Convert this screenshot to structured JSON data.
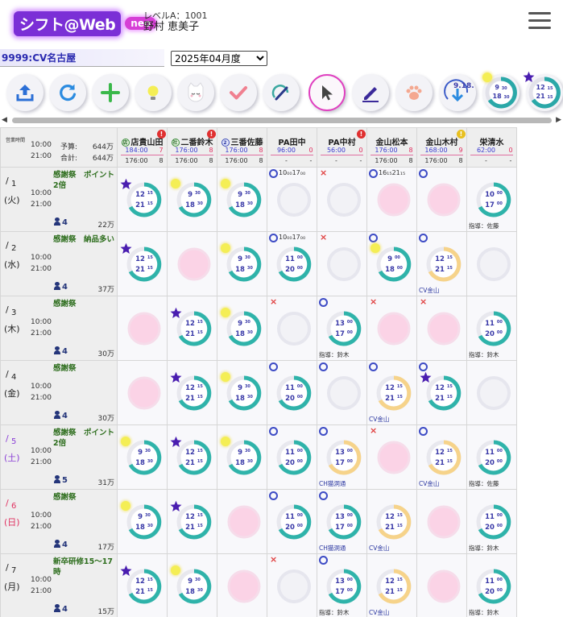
{
  "app": {
    "logo": "シフト@Web",
    "logo_badge": "neo",
    "level": "レベルA：1001",
    "user_name": "野村 恵美子"
  },
  "store": "9999:CV名古屋",
  "month": {
    "selected": "2025年04月度"
  },
  "toolbar": {
    "badge_sun_time": {
      "start": "9",
      "start_m": "30",
      "end": "18",
      "end_m": "30"
    },
    "badge_star_time": {
      "start": "12",
      "start_m": "15",
      "end": "21",
      "end_m": "15"
    },
    "download_label": "9.18."
  },
  "corner": {
    "label": "営業時間",
    "open": "10:00",
    "close": "21:00",
    "budget_label": "予算:",
    "budget_value": "644万",
    "total_label": "合計:",
    "total_value": "644万"
  },
  "staff": [
    {
      "name": "店貴山田",
      "badge": "店",
      "badge_color": "g",
      "alert": "!",
      "alert_color": "r",
      "h1": "184:00",
      "h1b": "7",
      "h2": "176:00",
      "h2b": "8"
    },
    {
      "name": "二番鈴木",
      "badge": "社",
      "badge_color": "g",
      "alert": "!",
      "alert_color": "r",
      "h1": "176:00",
      "h1b": "8",
      "h2": "176:00",
      "h2b": "8"
    },
    {
      "name": "三番佐藤",
      "badge": "2",
      "badge_color": "b",
      "alert": "",
      "alert_color": "",
      "h1": "176:00",
      "h1b": "8",
      "h2": "176:00",
      "h2b": "8"
    },
    {
      "name": "PA田中",
      "badge": "",
      "badge_color": "",
      "alert": "",
      "alert_color": "",
      "h1": "96:00",
      "h1b": "0",
      "h2": "-",
      "h2b": "-"
    },
    {
      "name": "PA中村",
      "badge": "",
      "badge_color": "",
      "alert": "!",
      "alert_color": "r",
      "h1": "56:00",
      "h1b": "0",
      "h2": "-",
      "h2b": "-"
    },
    {
      "name": "金山松本",
      "badge": "",
      "badge_color": "",
      "alert": "",
      "alert_color": "",
      "h1": "176:00",
      "h1b": "8",
      "h2": "176:00",
      "h2b": "8"
    },
    {
      "name": "金山木村",
      "badge": "",
      "badge_color": "",
      "alert": "!",
      "alert_color": "y",
      "h1": "168:00",
      "h1b": "9",
      "h2": "176:00",
      "h2b": "8"
    },
    {
      "name": "栄清水",
      "badge": "",
      "badge_color": "",
      "alert": "",
      "alert_color": "",
      "h1": "62:00",
      "h1b": "0",
      "h2": "-",
      "h2b": "-"
    }
  ],
  "days": [
    {
      "slash": "/",
      "num": "1",
      "wd": "(火)",
      "wd_color": "#222",
      "open": "10:00",
      "close": "21:00",
      "memo": "感謝祭　ポイント2倍",
      "staff_count": "4",
      "budget": "22万",
      "cells": [
        {
          "mark": "star",
          "time": [
            "12",
            "15",
            "21",
            "15"
          ],
          "ring": "teal"
        },
        {
          "mark": "sun",
          "time": [
            "9",
            "30",
            "18",
            "30"
          ],
          "ring": "teal"
        },
        {
          "mark": "sun",
          "time": [
            "9",
            "30",
            "18",
            "30"
          ],
          "ring": "teal"
        },
        {
          "mark": "o",
          "req": "10₀₀17₀₀",
          "ring": "empty"
        },
        {
          "mark": "x",
          "ring": "empty"
        },
        {
          "mark": "o",
          "req": "16₁₅21₁₅",
          "ring": "pink"
        },
        {
          "mark": "o",
          "ring": "pink"
        },
        {
          "mark": "",
          "time": [
            "10",
            "00",
            "17",
            "00"
          ],
          "ring": "teal",
          "note": "指導：佐藤"
        }
      ]
    },
    {
      "slash": "/",
      "num": "2",
      "wd": "(水)",
      "wd_color": "#222",
      "open": "10:00",
      "close": "21:00",
      "memo": "感謝祭　納品多い",
      "staff_count": "4",
      "budget": "37万",
      "cells": [
        {
          "mark": "star",
          "time": [
            "12",
            "15",
            "21",
            "15"
          ],
          "ring": "teal"
        },
        {
          "mark": "",
          "ring": "pink"
        },
        {
          "mark": "sun",
          "time": [
            "9",
            "30",
            "18",
            "30"
          ],
          "ring": "teal"
        },
        {
          "mark": "o",
          "req": "10₀₀17₀₀",
          "time": [
            "11",
            "00",
            "20",
            "00"
          ],
          "ring": "teal"
        },
        {
          "mark": "x",
          "ring": "empty"
        },
        {
          "mark": "o-sun",
          "time": [
            "9",
            "00",
            "18",
            "00"
          ],
          "ring": "teal"
        },
        {
          "mark": "o",
          "time": [
            "12",
            "15",
            "21",
            "15"
          ],
          "ring": "yellow",
          "note": "CV金山",
          "note_blue": true
        },
        {
          "mark": "",
          "ring": "empty"
        }
      ]
    },
    {
      "slash": "/",
      "num": "3",
      "wd": "(木)",
      "wd_color": "#222",
      "open": "10:00",
      "close": "21:00",
      "memo": "感謝祭",
      "staff_count": "4",
      "budget": "30万",
      "cells": [
        {
          "mark": "",
          "ring": "pink"
        },
        {
          "mark": "star",
          "time": [
            "12",
            "15",
            "21",
            "15"
          ],
          "ring": "teal"
        },
        {
          "mark": "sun",
          "time": [
            "9",
            "30",
            "18",
            "30"
          ],
          "ring": "teal"
        },
        {
          "mark": "x",
          "ring": "empty"
        },
        {
          "mark": "o",
          "time": [
            "13",
            "00",
            "17",
            "00"
          ],
          "ring": "teal",
          "note": "指導：鈴木"
        },
        {
          "mark": "x",
          "ring": "pink"
        },
        {
          "mark": "x",
          "ring": "pink"
        },
        {
          "mark": "",
          "time": [
            "11",
            "00",
            "20",
            "00"
          ],
          "ring": "teal",
          "note": "指導：鈴木"
        }
      ]
    },
    {
      "slash": "/",
      "num": "4",
      "wd": "(金)",
      "wd_color": "#222",
      "open": "10:00",
      "close": "21:00",
      "memo": "感謝祭",
      "staff_count": "4",
      "budget": "30万",
      "cells": [
        {
          "mark": "",
          "ring": "pink"
        },
        {
          "mark": "star",
          "time": [
            "12",
            "15",
            "21",
            "15"
          ],
          "ring": "teal"
        },
        {
          "mark": "sun",
          "time": [
            "9",
            "30",
            "18",
            "30"
          ],
          "ring": "teal"
        },
        {
          "mark": "o",
          "time": [
            "11",
            "00",
            "20",
            "00"
          ],
          "ring": "teal"
        },
        {
          "mark": "o",
          "ring": "empty"
        },
        {
          "mark": "o",
          "time": [
            "12",
            "15",
            "21",
            "15"
          ],
          "ring": "yellow",
          "note": "CV金山",
          "note_blue": true
        },
        {
          "mark": "o-star",
          "time": [
            "12",
            "15",
            "21",
            "15"
          ],
          "ring": "teal"
        },
        {
          "mark": "",
          "ring": "empty"
        }
      ]
    },
    {
      "slash": "/",
      "num": "5",
      "wd": "(土)",
      "wd_color": "#8a3ed6",
      "open": "10:00",
      "close": "21:00",
      "memo": "感謝祭　ポイント2倍",
      "staff_count": "5",
      "budget": "31万",
      "cells": [
        {
          "mark": "sun",
          "time": [
            "9",
            "30",
            "18",
            "30"
          ],
          "ring": "teal"
        },
        {
          "mark": "star",
          "time": [
            "12",
            "15",
            "21",
            "15"
          ],
          "ring": "teal"
        },
        {
          "mark": "sun",
          "time": [
            "9",
            "30",
            "18",
            "30"
          ],
          "ring": "teal"
        },
        {
          "mark": "o",
          "time": [
            "11",
            "00",
            "20",
            "00"
          ],
          "ring": "teal"
        },
        {
          "mark": "o",
          "time": [
            "13",
            "00",
            "17",
            "00"
          ],
          "ring": "yellow",
          "note": "CH猫洞通",
          "note_blue": true
        },
        {
          "mark": "x",
          "ring": "pink"
        },
        {
          "mark": "o",
          "time": [
            "12",
            "15",
            "21",
            "15"
          ],
          "ring": "yellow",
          "note": "CV金山",
          "note_blue": true
        },
        {
          "mark": "",
          "time": [
            "11",
            "00",
            "20",
            "00"
          ],
          "ring": "teal",
          "note": "指導：佐藤"
        }
      ]
    },
    {
      "slash": "/",
      "num": "6",
      "wd": "(日)",
      "wd_color": "#e03060",
      "open": "10:00",
      "close": "21:00",
      "memo": "感謝祭",
      "staff_count": "4",
      "budget": "17万",
      "cells": [
        {
          "mark": "sun",
          "time": [
            "9",
            "30",
            "18",
            "30"
          ],
          "ring": "teal"
        },
        {
          "mark": "star",
          "time": [
            "12",
            "15",
            "21",
            "15"
          ],
          "ring": "teal"
        },
        {
          "mark": "",
          "ring": "pink"
        },
        {
          "mark": "o",
          "time": [
            "11",
            "00",
            "20",
            "00"
          ],
          "ring": "teal"
        },
        {
          "mark": "o",
          "time": [
            "13",
            "00",
            "17",
            "00"
          ],
          "ring": "teal",
          "note": "CH猫洞通",
          "note_blue": true
        },
        {
          "mark": "",
          "time": [
            "12",
            "15",
            "21",
            "15"
          ],
          "ring": "yellow",
          "note": "CV金山",
          "note_blue": true
        },
        {
          "mark": "",
          "ring": "pink"
        },
        {
          "mark": "",
          "time": [
            "11",
            "00",
            "20",
            "00"
          ],
          "ring": "teal",
          "note": "指導：鈴木"
        }
      ]
    },
    {
      "slash": "/",
      "num": "7",
      "wd": "(月)",
      "wd_color": "#222",
      "open": "10:00",
      "close": "21:00",
      "memo": "新卒研修15～17時",
      "staff_count": "4",
      "budget": "15万",
      "cells": [
        {
          "mark": "star",
          "time": [
            "12",
            "15",
            "21",
            "15"
          ],
          "ring": "teal"
        },
        {
          "mark": "sun",
          "time": [
            "9",
            "30",
            "18",
            "30"
          ],
          "ring": "teal"
        },
        {
          "mark": "",
          "ring": "pink"
        },
        {
          "mark": "x",
          "ring": "empty"
        },
        {
          "mark": "o",
          "time": [
            "13",
            "00",
            "17",
            "00"
          ],
          "ring": "teal",
          "note": "指導：鈴木"
        },
        {
          "mark": "",
          "time": [
            "12",
            "15",
            "21",
            "15"
          ],
          "ring": "yellow",
          "note": "CV金山",
          "note_blue": true
        },
        {
          "mark": "",
          "ring": "pink"
        },
        {
          "mark": "",
          "time": [
            "11",
            "00",
            "20",
            "00"
          ],
          "ring": "teal",
          "note": "指導：鈴木"
        }
      ]
    }
  ]
}
